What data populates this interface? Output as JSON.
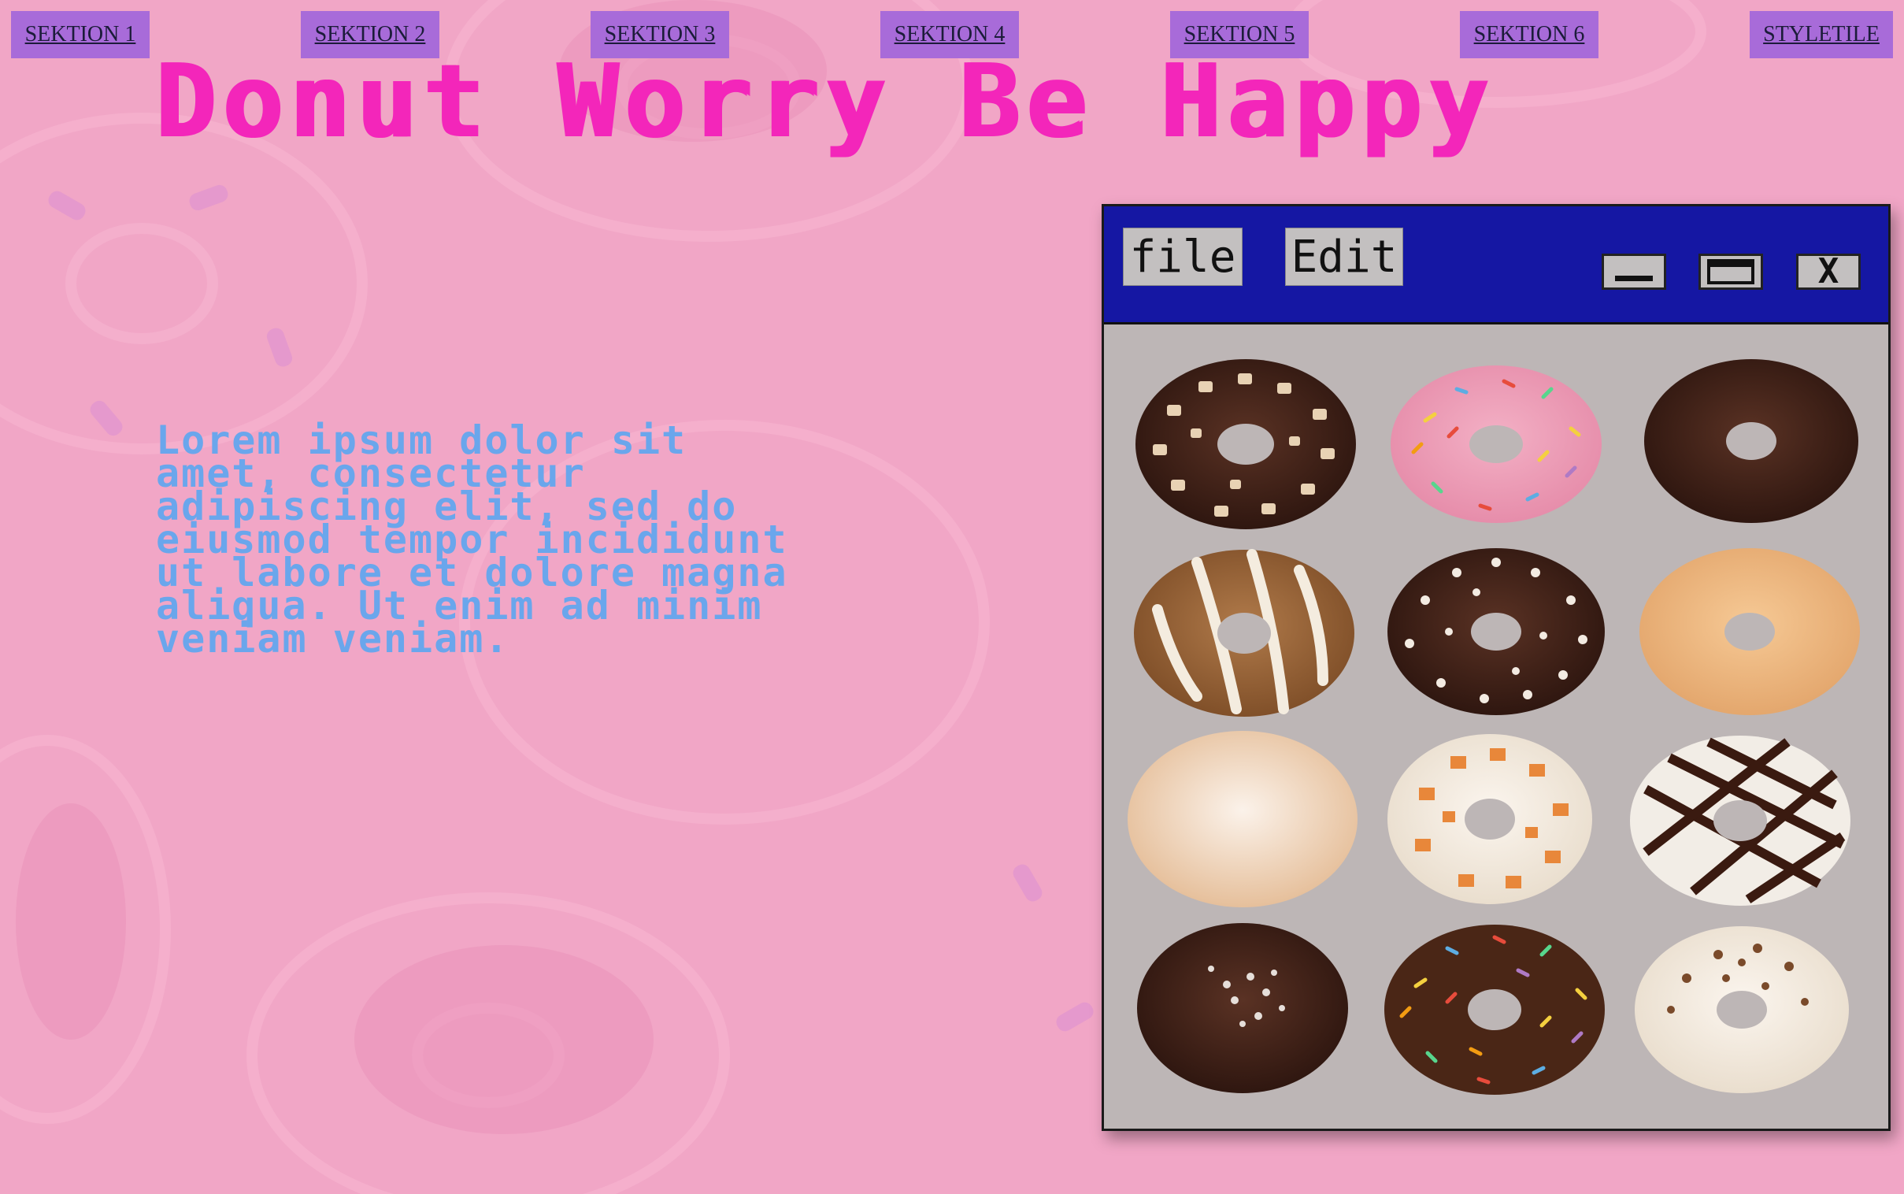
{
  "nav": {
    "items": [
      {
        "label": "SEKTION 1"
      },
      {
        "label": "SEKTION 2"
      },
      {
        "label": "SEKTION 3"
      },
      {
        "label": "SEKTION 4"
      },
      {
        "label": "SEKTION 5"
      },
      {
        "label": "SEKTION 6"
      },
      {
        "label": "STYLETILE"
      }
    ]
  },
  "hero": {
    "title": "Donut Worry Be Happy",
    "body": "Lorem ipsum dolor sit amet, consectetur adipiscing elit, sed do eiusmod tempor incididunt ut labore et dolore magna aliqua. Ut enim ad minim veniam veniam."
  },
  "window": {
    "menu": {
      "file": "file",
      "edit": "Edit"
    },
    "controls": [
      "minimize-icon",
      "maximize-icon",
      "close-icon"
    ],
    "close_glyph": "X",
    "gallery": [
      {
        "name": "donut-chocolate-nuts"
      },
      {
        "name": "donut-pink-sprinkles"
      },
      {
        "name": "donut-dark-chocolate"
      },
      {
        "name": "donut-white-striped"
      },
      {
        "name": "donut-chocolate-white-bits"
      },
      {
        "name": "donut-sugar-glazed"
      },
      {
        "name": "donut-powdered"
      },
      {
        "name": "donut-white-orange-bits"
      },
      {
        "name": "donut-chocolate-drizzle"
      },
      {
        "name": "donut-chocolate-coconut"
      },
      {
        "name": "donut-rainbow-sprinkles"
      },
      {
        "name": "donut-white-chocolate-shavings"
      }
    ]
  },
  "colors": {
    "background": "#f1a6c6",
    "nav_tab": "#a86bd9",
    "title": "#f326ba",
    "body_text": "#6aa6ec",
    "window_titlebar": "#1517a3",
    "window_body": "#bdb6b6"
  }
}
